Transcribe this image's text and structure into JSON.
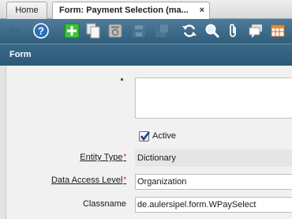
{
  "tabs": [
    {
      "label": "Home"
    },
    {
      "label": "Form: Payment Selection (ma..."
    }
  ],
  "tab_close_symbol": "×",
  "toolbar": {
    "icons": [
      "undo-icon",
      "help-icon",
      "new-record-icon",
      "copy-record-icon",
      "delete-record-icon",
      "save-icon",
      "save-new-icon",
      "refresh-icon",
      "find-icon",
      "attachment-icon",
      "chat-icon",
      "grid-toggle-icon"
    ],
    "colors": {
      "bar_top": "#4f7c99",
      "bar_bottom": "#2f5d7b",
      "new_button": "#3cc43c",
      "help_button": "#2b6fb6"
    }
  },
  "form": {
    "header_title": "Form",
    "active_label": "Active",
    "active_checked": true,
    "fields": [
      {
        "label": "Entity Type",
        "value": "Dictionary",
        "required": true,
        "link": true,
        "editable": false
      },
      {
        "label": "Data Access Level",
        "value": "Organization",
        "required": true,
        "link": true,
        "editable": true
      },
      {
        "label": "Classname",
        "value": "de.aulersipel.form.WPaySelect",
        "required": false,
        "link": false,
        "editable": true
      }
    ],
    "required_marker": "*"
  }
}
